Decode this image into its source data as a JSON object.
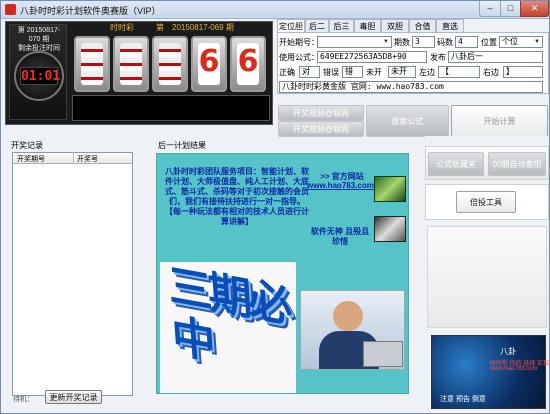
{
  "window": {
    "title": "八卦时时彩计划软件奥赛版（VIP）",
    "minimize": "–",
    "maximize": "□",
    "close": "✕"
  },
  "lottery": {
    "clock_label": "第 20150817-070 期\n剩余投注时间",
    "countdown": "01:01",
    "brand": "时时彩",
    "issue_prefix": "第",
    "issue": "20150817-069",
    "issue_suffix": "期",
    "digits": [
      "",
      "",
      "",
      "6",
      "6"
    ]
  },
  "tabs": [
    "定位胆",
    "后二",
    "后三",
    "毒胆",
    "双胆",
    "合值",
    "直选"
  ],
  "form": {
    "start_period_label": "开始期号：",
    "start_period_value": "",
    "periods_label": "期数",
    "periods_value": "3",
    "code_count_label": "码数",
    "code_count_value": "4",
    "position_label": "位置",
    "position_value": "个位",
    "formula_label": "使用公式：",
    "formula_value": "649EE272563A5D8+90",
    "publish_label": "发布",
    "publish_value": "八卦后一",
    "correct_label": "正确",
    "correct_value": "对",
    "wrong_label": "错误",
    "wrong_value": "错",
    "notopen_label": "未开",
    "notopen_value": "未开",
    "left_label": "左边",
    "left_value": "【",
    "right_label": "右边",
    "right_value": "】",
    "banner_value": "八卦时时彩黄金版 官网: www.hao783.com"
  },
  "buttons": {
    "start_video_1": "开奖视频@联网",
    "start_video_2": "开奖视频@联网",
    "search_formula": "搜索公式",
    "start_calc": "开始计算",
    "favorite_formula": "公式收藏夹",
    "auto_apply": "00期自动套用",
    "bet_tool": "倍投工具",
    "update_history": "更新开奖记录"
  },
  "history": {
    "title": "开奖记录",
    "columns": [
      "开奖期号",
      "开奖号"
    ],
    "rows": [],
    "status": "待机："
  },
  "plan": {
    "title": "后一计划结果",
    "ad_text": "八卦时时彩团队服务项目：智能计划、软件计划、大师极值盘、纯人工计划、大底式、筋斗式、杀码等对于初次接触的会员们，我们有接待扶持进行一对一指导。\n【每一种玩法都有相对的技术人员进行计算讲解】",
    "ad_link_label": ">> 官方网站",
    "ad_link": "www.hao783.com",
    "ad_slogan": "软件无神 且殁且珍惜",
    "ad_bigtext": "三期必中"
  },
  "right_ad": {
    "line1": "八卦",
    "line2": "时时彩 你的 选择 实现",
    "line3": "www.hao783.com",
    "line4": "注意 预告 倒意"
  }
}
